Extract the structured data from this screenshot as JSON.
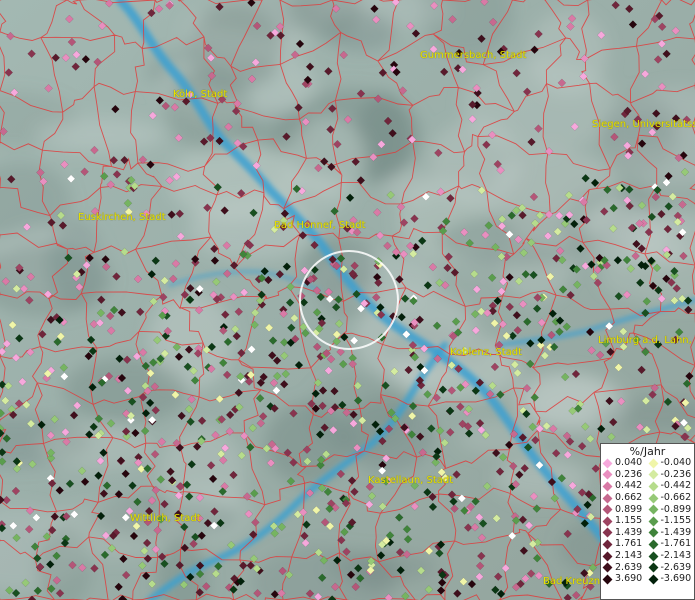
{
  "cities": [
    {
      "id": "koeln",
      "label": "Köln, Stadt"
    },
    {
      "id": "gummersbach",
      "label": "Gummersbach, Stadt"
    },
    {
      "id": "siegen",
      "label": "Siegen, Universitätss"
    },
    {
      "id": "euskirchen",
      "label": "Euskirchen, Stadt"
    },
    {
      "id": "bad-honnef",
      "label": "Bad Honnef, Stadt"
    },
    {
      "id": "koblenz",
      "label": "Koblenz, Stadt"
    },
    {
      "id": "limburg",
      "label": "Limburg a.d. Lahn, K"
    },
    {
      "id": "kastellaun",
      "label": "Kastellaun, Stadt"
    },
    {
      "id": "wittlich",
      "label": "Wittlich, Stadt"
    },
    {
      "id": "bad-kreuznach",
      "label": "Bad Kreuzn"
    }
  ],
  "legend": {
    "title": "%/Jahr",
    "positive": [
      {
        "label": "0.040",
        "color": "#f6a8dc"
      },
      {
        "label": "0.236",
        "color": "#e98fc0"
      },
      {
        "label": "0.442",
        "color": "#d97aa6"
      },
      {
        "label": "0.662",
        "color": "#c7698f"
      },
      {
        "label": "0.899",
        "color": "#b45678"
      },
      {
        "label": "1.155",
        "color": "#9e4462"
      },
      {
        "label": "1.439",
        "color": "#88344f"
      },
      {
        "label": "1.761",
        "color": "#70263c"
      },
      {
        "label": "2.143",
        "color": "#581a2b"
      },
      {
        "label": "2.639",
        "color": "#3f0f1c"
      },
      {
        "label": "3.690",
        "color": "#26050d"
      }
    ],
    "negative": [
      {
        "label": "-0.040",
        "color": "#f0f5a8"
      },
      {
        "label": "-0.236",
        "color": "#d4eba0"
      },
      {
        "label": "-0.442",
        "color": "#b6dc8c"
      },
      {
        "label": "-0.662",
        "color": "#96c977"
      },
      {
        "label": "-0.899",
        "color": "#76b461"
      },
      {
        "label": "-1.155",
        "color": "#5a9d4d"
      },
      {
        "label": "-1.439",
        "color": "#40843b"
      },
      {
        "label": "-1.761",
        "color": "#2a6a2c"
      },
      {
        "label": "-2.143",
        "color": "#185020"
      },
      {
        "label": "-2.639",
        "color": "#0b3714"
      },
      {
        "label": "-3.690",
        "color": "#02200a"
      }
    ]
  },
  "colors": {
    "river": "#3aa0d2",
    "boundary": "#e03a3a",
    "label": "#e8e200",
    "highlight_circle": "#ffffff"
  }
}
